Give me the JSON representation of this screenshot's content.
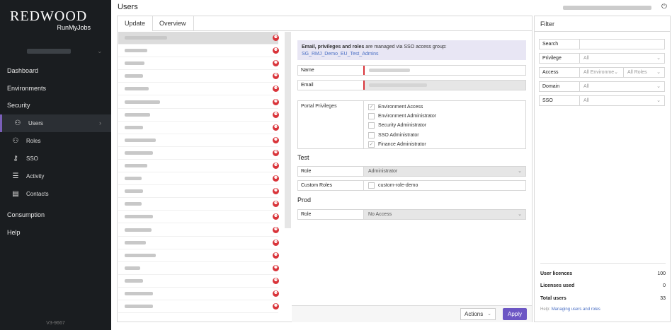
{
  "brand": {
    "name": "REDWOOD",
    "product": "RunMyJobs"
  },
  "sidebar": {
    "main_items": [
      {
        "label": "Dashboard"
      },
      {
        "label": "Environments"
      },
      {
        "label": "Security"
      }
    ],
    "security_items": [
      {
        "label": "Users",
        "icon": "user-icon",
        "glyph": "⚇",
        "active": true
      },
      {
        "label": "Roles",
        "icon": "roles-icon",
        "glyph": "⚇",
        "active": false
      },
      {
        "label": "SSO",
        "icon": "key-icon",
        "glyph": "⚷",
        "active": false
      },
      {
        "label": "Activity",
        "icon": "activity-icon",
        "glyph": "☰",
        "active": false
      },
      {
        "label": "Contacts",
        "icon": "contacts-icon",
        "glyph": "▤",
        "active": false
      }
    ],
    "bottom_items": [
      {
        "label": "Consumption"
      },
      {
        "label": "Help"
      }
    ],
    "version": "V3-9667"
  },
  "header": {
    "title": "Users"
  },
  "tabs": [
    {
      "label": "Update"
    },
    {
      "label": "Overview"
    }
  ],
  "user_list": {
    "count": 22,
    "badge_glyph": "⚉"
  },
  "detail": {
    "sso_notice_bold": "Email, privileges and roles",
    "sso_notice_rest": " are managed via SSO access group:",
    "sso_group": "SG_RMJ_Demo_EU_Test_Admins",
    "name_label": "Name",
    "email_label": "Email",
    "privileges_label": "Portal Privileges",
    "privileges": [
      {
        "label": "Environment Access",
        "checked": true
      },
      {
        "label": "Environment Administrator",
        "checked": false
      },
      {
        "label": "Security Administrator",
        "checked": false
      },
      {
        "label": "SSO Administrator",
        "checked": false
      },
      {
        "label": "Finance Administrator",
        "checked": true
      }
    ],
    "test_section": "Test",
    "test_role_label": "Role",
    "test_role_value": "Administrator",
    "custom_roles_label": "Custom Roles",
    "custom_role_option": "custom-role-demo",
    "prod_section": "Prod",
    "prod_role_label": "Role",
    "prod_role_value": "No Access"
  },
  "footer": {
    "actions_label": "Actions",
    "apply_label": "Apply"
  },
  "filter": {
    "title": "Filter",
    "search_label": "Search",
    "privilege_label": "Privilege",
    "privilege_value": "All",
    "access_label": "Access",
    "access_env_value": "All Environme",
    "access_roles_value": "All Roles",
    "domain_label": "Domain",
    "domain_value": "All",
    "sso_label": "SSO",
    "sso_value": "All"
  },
  "stats": [
    {
      "label": "User licences",
      "value": "100"
    },
    {
      "label": "Licenses used",
      "value": "0"
    },
    {
      "label": "Total users",
      "value": "33"
    }
  ],
  "help": {
    "prefix": "Help:",
    "link": "Managing users and roles"
  },
  "colors": {
    "accent": "#6c56c4",
    "badge": "#d9343a",
    "sidebar_bg": "#1a1d20"
  }
}
